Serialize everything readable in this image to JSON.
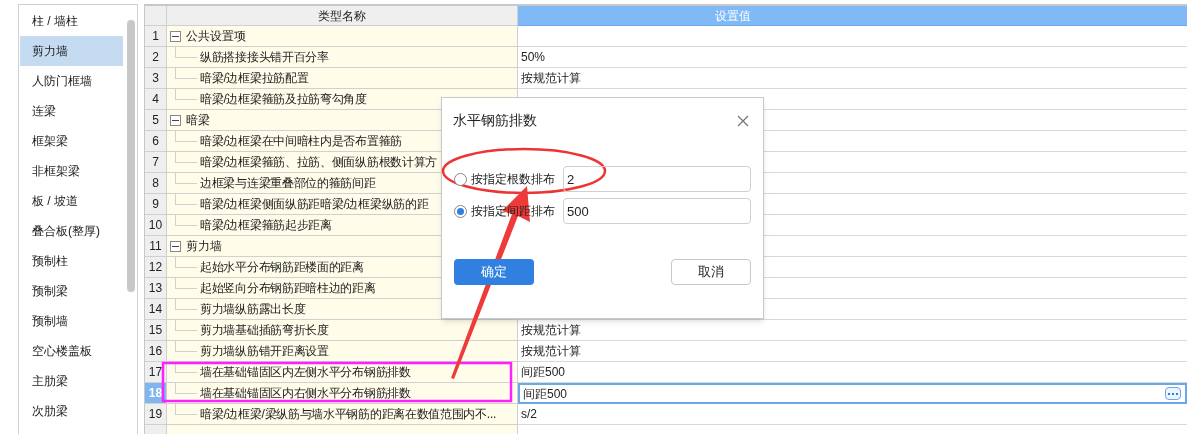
{
  "sidebar": {
    "items": [
      {
        "label": "柱 / 墙柱",
        "selected": false
      },
      {
        "label": "剪力墙",
        "selected": true
      },
      {
        "label": "人防门框墙",
        "selected": false
      },
      {
        "label": "连梁",
        "selected": false
      },
      {
        "label": "框架梁",
        "selected": false
      },
      {
        "label": "非框架梁",
        "selected": false
      },
      {
        "label": "板 / 坡道",
        "selected": false
      },
      {
        "label": "叠合板(整厚)",
        "selected": false
      },
      {
        "label": "预制柱",
        "selected": false
      },
      {
        "label": "预制梁",
        "selected": false
      },
      {
        "label": "预制墙",
        "selected": false
      },
      {
        "label": "空心楼盖板",
        "selected": false
      },
      {
        "label": "主肋梁",
        "selected": false
      },
      {
        "label": "次肋梁",
        "selected": false
      }
    ]
  },
  "table": {
    "columns": [
      "类型名称",
      "设置值"
    ],
    "groups": [
      {
        "number": "1",
        "name": "公共设置项",
        "expanded": true,
        "children": [
          {
            "number": "2",
            "name": "纵筋搭接接头错开百分率",
            "value": "50%",
            "selected": false
          },
          {
            "number": "3",
            "name": "暗梁/边框梁拉筋配置",
            "value": "按规范计算",
            "selected": false
          },
          {
            "number": "4",
            "name": "暗梁/边框梁箍筋及拉筋弯勾角度",
            "selected": false
          }
        ]
      },
      {
        "number": "5",
        "name": "暗梁",
        "expanded": true,
        "children": [
          {
            "number": "6",
            "name": "暗梁/边框梁在中间暗柱内是否布置箍筋",
            "selected": false
          },
          {
            "number": "7",
            "name": "暗梁/边框梁箍筋、拉筋、侧面纵筋根数计算方",
            "selected": false
          },
          {
            "number": "8",
            "name": "边框梁与连梁重叠部位的箍筋间距",
            "selected": false
          },
          {
            "number": "9",
            "name": "暗梁/边框梁侧面纵筋距暗梁/边框梁纵筋的距",
            "selected": false
          },
          {
            "number": "10",
            "name": "暗梁/边框梁箍筋起步距离",
            "selected": false
          }
        ]
      },
      {
        "number": "11",
        "name": "剪力墙",
        "expanded": true,
        "children": [
          {
            "number": "12",
            "name": "起始水平分布钢筋距楼面的距离",
            "selected": false
          },
          {
            "number": "13",
            "name": "起始竖向分布钢筋距暗柱边的距离",
            "selected": false
          },
          {
            "number": "14",
            "name": "剪力墙纵筋露出长度",
            "selected": false
          },
          {
            "number": "15",
            "name": "剪力墙基础插筋弯折长度",
            "value": "按规范计算",
            "selected": false
          },
          {
            "number": "16",
            "name": "剪力墙纵筋错开距离设置",
            "value": "按规范计算",
            "selected": false
          },
          {
            "number": "17",
            "name": "墙在基础锚固区内左侧水平分布钢筋排数",
            "value": "间距500",
            "selected": false
          },
          {
            "number": "18",
            "name": "墙在基础锚固区内右侧水平分布钢筋排数",
            "value": "间距500",
            "selected": true
          },
          {
            "number": "19",
            "name": "暗梁/边框梁/梁纵筋与墙水平钢筋的距离在数值范围内不...",
            "value": "s/2",
            "selected": false
          }
        ]
      }
    ]
  },
  "dialog": {
    "title": "水平钢筋排数",
    "options": [
      {
        "label": "按指定根数排布",
        "value": "2",
        "selected": false
      },
      {
        "label": "按指定间距排布",
        "value": "500",
        "selected": true
      }
    ],
    "buttons": [
      "确定",
      "取消"
    ]
  }
}
